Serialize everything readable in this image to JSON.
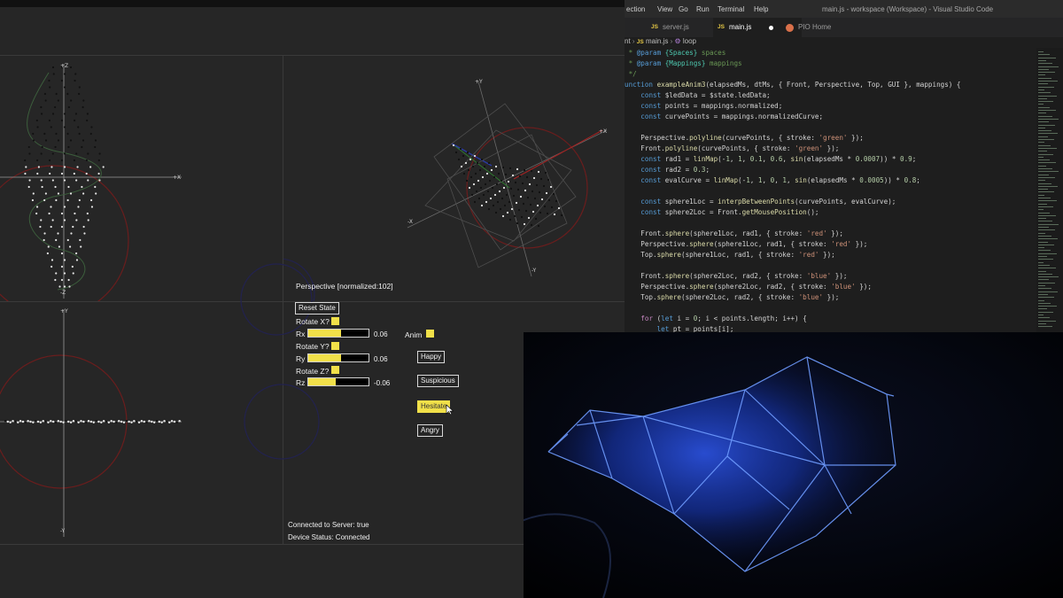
{
  "visualizer": {
    "viewport_title": "Perspective [normalized:102]",
    "axis_labels": {
      "plus_x": "+X",
      "minus_x": "-X",
      "plus_y": "+Y",
      "minus_y": "-Y",
      "plus_z": "+Z",
      "minus_z": "-Z"
    },
    "reset_label": "Reset State",
    "rotate_x_label": "Rotate X?",
    "rotate_y_label": "Rotate Y?",
    "rotate_z_label": "Rotate Z?",
    "rotate_x_checked": true,
    "rotate_y_checked": true,
    "rotate_z_checked": true,
    "sliders": [
      {
        "label": "Rx",
        "value": "0.06",
        "fill": 0.55
      },
      {
        "label": "Ry",
        "value": "0.06",
        "fill": 0.55
      },
      {
        "label": "Rz",
        "value": "-0.06",
        "fill": 0.45
      }
    ],
    "anim_label": "Anim",
    "anim_checked": true,
    "buttons": [
      "Happy",
      "Suspicious",
      "Hesitate",
      "Angry"
    ],
    "active_button": "Hesitate",
    "status_server": "Connected to Server: true",
    "status_device": "Device Status: Connected",
    "colors": {
      "accent": "#f1e049",
      "red_circle": "#7a1f1f",
      "blue_circle": "#24245a",
      "green_curve": "#3f6b3f"
    }
  },
  "vscode": {
    "menu": [
      "ection",
      "View",
      "Go",
      "Run",
      "Terminal",
      "Help"
    ],
    "window_title": "main.js - workspace (Workspace) - Visual Studio Code",
    "tabs": [
      {
        "label": "server.js",
        "icon": "js-icon",
        "active": false
      },
      {
        "label": "main.js",
        "icon": "js-icon",
        "active": true,
        "modified": true
      },
      {
        "label": "PIO Home",
        "icon": "pio-icon",
        "active": false
      }
    ],
    "breadcrumb": {
      "root": "nt",
      "file": "main.js",
      "symbol": "loop"
    },
    "code_lines": [
      " * @param {Spaces} spaces",
      " * @param {Mappings} mappings",
      " */",
      "unction exampleAnim3(elapsedMs, dtMs, { Front, Perspective, Top, GUI }, mappings) {",
      "    const $ledData = $state.ledData;",
      "    const points = mappings.normalized;",
      "    const curvePoints = mappings.normalizedCurve;",
      "",
      "    Perspective.polyline(curvePoints, { stroke: 'green' });",
      "    Front.polyline(curvePoints, { stroke: 'green' });",
      "    const rad1 = linMap(-1, 1, 0.1, 0.6, sin(elapsedMs * 0.0007)) * 0.9;",
      "    const rad2 = 0.3;",
      "    const evalCurve = linMap(-1, 1, 0, 1, sin(elapsedMs * 0.0005)) * 0.8;",
      "",
      "    const sphere1Loc = interpBetweenPoints(curvePoints, evalCurve);",
      "    const sphere2Loc = Front.getMousePosition();",
      "",
      "    Front.sphere(sphere1Loc, rad1, { stroke: 'red' });",
      "    Perspective.sphere(sphere1Loc, rad1, { stroke: 'red' });",
      "    Top.sphere(sphere1Loc, rad1, { stroke: 'red' });",
      "",
      "    Front.sphere(sphere2Loc, rad2, { stroke: 'blue' });",
      "    Perspective.sphere(sphere2Loc, rad2, { stroke: 'blue' });",
      "    Top.sphere(sphere2Loc, rad2, { stroke: 'blue' });",
      "",
      "    for (let i = 0; i < points.length; i++) {",
      "        let pt = points[i];"
    ]
  }
}
